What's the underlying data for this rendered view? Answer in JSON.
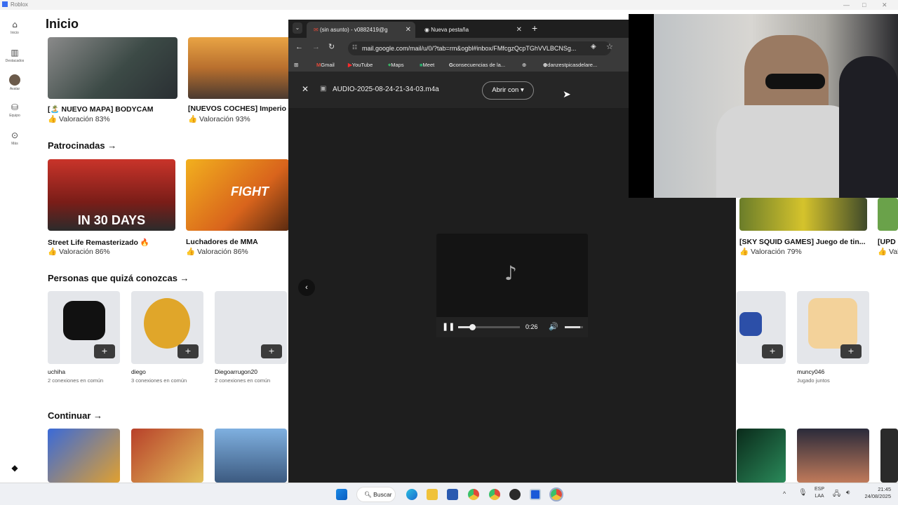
{
  "roblox": {
    "window_title": "Roblox",
    "sidebar": [
      {
        "label": "Inicio",
        "icon": "home-icon"
      },
      {
        "label": "Destacados",
        "icon": "charts-icon"
      },
      {
        "label": "Avatar",
        "icon": "avatar-icon"
      },
      {
        "label": "Equipo",
        "icon": "inventory-icon"
      },
      {
        "label": "Más",
        "icon": "more-icon"
      }
    ],
    "title": "Inicio",
    "games_row1": [
      {
        "name": "[🏝️ NUEVO MAPA] BODYCAM",
        "rating": "Valoración 83%"
      },
      {
        "name": "[NUEVOS COCHES] Imperio",
        "rating": "Valoración 93%"
      }
    ],
    "sponsored": {
      "heading": "Patrocinadas →",
      "games": [
        {
          "name": "Street Life Remasterizado 🔥",
          "rating": "Valoración 86%",
          "overlay": "IN 30 DAYS"
        },
        {
          "name": "Luchadores de MMA",
          "rating": "Valoración 86%",
          "overlay": "FIGHT"
        }
      ],
      "right_games": [
        {
          "name": "[SKY SQUID GAMES] Juego de tin...",
          "rating": "Valoración 79%"
        },
        {
          "name": "[UPD",
          "rating": "Valo"
        }
      ]
    },
    "people": {
      "heading": "Personas que quizá conozcas →",
      "list": [
        {
          "name": "uchiha",
          "mutual": "2 conexiones en común"
        },
        {
          "name": "diego",
          "mutual": "3 conexiones en común"
        },
        {
          "name": "Diegoarrugon20",
          "mutual": "2 conexiones en común"
        },
        {
          "name": "muncy046",
          "mutual": "Jugado juntos"
        }
      ]
    },
    "continue_heading": "Continuar →"
  },
  "chrome": {
    "tabs": [
      {
        "label": "(sin asunto) - v0882419@g",
        "active": true
      },
      {
        "label": "Nueva pestaña",
        "active": false
      }
    ],
    "new_tab": "+",
    "url": "mail.google.com/mail/u/0/?tab=rm&ogbl#inbox/FMfcgzQcpTGhVVLBCNSg...",
    "bookmarks": [
      "Gmail",
      "YouTube",
      "Maps",
      "Meet",
      "consecuencias de la...",
      "danzestpicasdelare..."
    ],
    "viewer": {
      "file_name": "AUDIO-2025-08-24-21-34-03.m4a",
      "open_with": "Abrir con",
      "time": "0:26",
      "progress": 0.23,
      "volume": 0.85,
      "music_icon": "music-note-icon"
    }
  },
  "taskbar": {
    "search": "Buscar",
    "lang_top": "ESP",
    "lang_bottom": "LAA",
    "time": "21:45",
    "date": "24/08/2025"
  }
}
